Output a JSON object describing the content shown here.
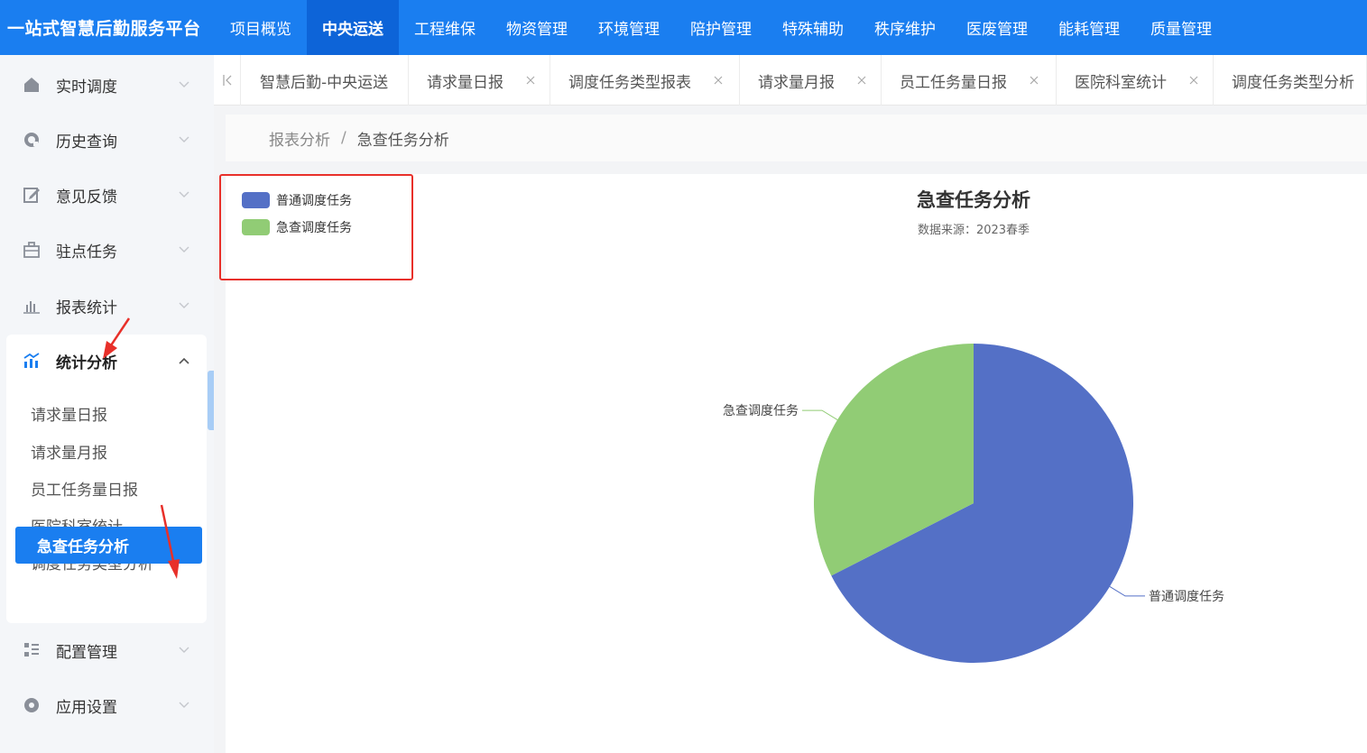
{
  "app": {
    "title": "一站式智慧后勤服务平台"
  },
  "topnav": {
    "items": [
      "项目概览",
      "中央运送",
      "工程维保",
      "物资管理",
      "环境管理",
      "陪护管理",
      "特殊辅助",
      "秩序维护",
      "医废管理",
      "能耗管理",
      "质量管理"
    ],
    "active": "中央运送"
  },
  "sidebar": {
    "items": [
      {
        "label": "实时调度",
        "icon": "home-icon"
      },
      {
        "label": "历史查询",
        "icon": "history-icon"
      },
      {
        "label": "意见反馈",
        "icon": "edit-icon"
      },
      {
        "label": "驻点任务",
        "icon": "briefcase-icon"
      },
      {
        "label": "报表统计",
        "icon": "bar-chart-icon"
      },
      {
        "label": "统计分析",
        "icon": "analysis-icon"
      },
      {
        "label": "配置管理",
        "icon": "config-icon"
      },
      {
        "label": "应用设置",
        "icon": "settings-icon"
      }
    ],
    "submenu": [
      "请求量日报",
      "请求量月报",
      "员工任务量日报",
      "医院科室统计",
      "调度任务类型分析",
      "急查任务分析"
    ],
    "active_sub": "急查任务分析"
  },
  "tabs": [
    {
      "label": "智慧后勤-中央运送",
      "closable": false
    },
    {
      "label": "请求量日报",
      "closable": true
    },
    {
      "label": "调度任务类型报表",
      "closable": true
    },
    {
      "label": "请求量月报",
      "closable": true
    },
    {
      "label": "员工任务量日报",
      "closable": true
    },
    {
      "label": "医院科室统计",
      "closable": true
    },
    {
      "label": "调度任务类型分析",
      "closable": false
    }
  ],
  "breadcrumb": {
    "parent": "报表分析",
    "separator": "/",
    "current": "急查任务分析"
  },
  "colors": {
    "primary": "#1a7ef0",
    "series_normal": "#5470c6",
    "series_urgent": "#91cc75",
    "highlight": "#e8302a"
  },
  "chart_data": {
    "type": "pie",
    "title": "急查任务分析",
    "subtitle": "数据来源：2023春季",
    "legend_position": "top-left",
    "series": [
      {
        "name": "普通调度任务",
        "value": 67.5,
        "color": "#5470c6"
      },
      {
        "name": "急查调度任务",
        "value": 32.5,
        "color": "#91cc75"
      }
    ]
  }
}
